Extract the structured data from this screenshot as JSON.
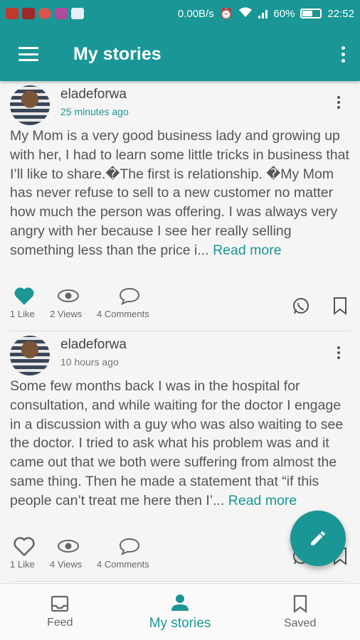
{
  "status": {
    "net_speed": "0.00B/s",
    "signal_label": ".ıl",
    "battery": "60%",
    "battery_level": 0.6,
    "time": "22:52"
  },
  "appbar": {
    "title": "My stories"
  },
  "stories": [
    {
      "author": "eladeforwa",
      "time": "25 minutes ago",
      "excerpt": "My Mom is a very good business lady and growing up with her, I had to learn some little tricks in business that I’ll like to share.�The first is relationship. �My Mom has never refuse to sell to a new customer no matter how much the person was offering. I was always very angry with her because I see her really selling something less than the price i...",
      "read_more": "Read more",
      "likes": "1 Like",
      "liked": true,
      "views": "2 Views",
      "comments": "4 Comments"
    },
    {
      "author": "eladeforwa",
      "time": "10 hours ago",
      "excerpt": "Some few months back I was in the hospital for consultation, and while waiting for the doctor I engage in a discussion with a guy who was also waiting to see the doctor. I tried to ask what his problem was and it came out that we both were suffering from almost the same thing. Then he made a statement that “if this people can’t treat me here then I’...",
      "read_more": "Read more",
      "likes": "1 Like",
      "liked": false,
      "views": "4 Views",
      "comments": "4 Comments"
    }
  ],
  "nav": {
    "feed": "Feed",
    "my_stories": "My stories",
    "saved": "Saved"
  },
  "colors": {
    "accent": "#1a9696"
  },
  "icons": [
    "menu-icon",
    "more-vert-icon",
    "heart-icon",
    "eye-icon",
    "comment-icon",
    "whatsapp-icon",
    "bookmark-icon",
    "pencil-icon",
    "inbox-icon",
    "person-icon"
  ]
}
